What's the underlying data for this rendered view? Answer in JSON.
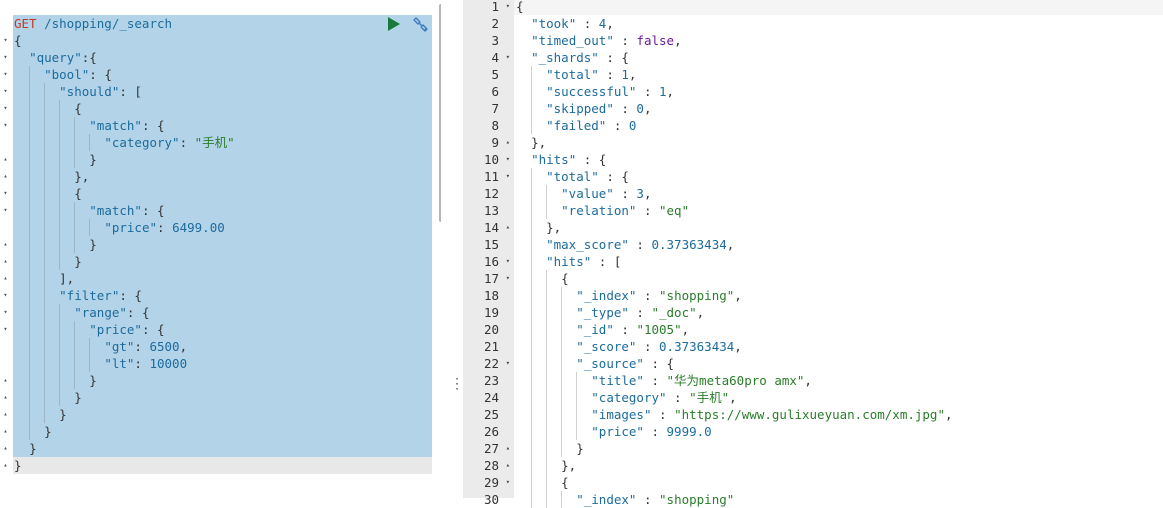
{
  "request": {
    "method": "GET",
    "path": " /shopping/_search",
    "run_icon": "play-icon",
    "settings_icon": "wrench-icon"
  },
  "request_lines": [
    {
      "i": 0,
      "parts": [
        {
          "t": "{",
          "c": "p"
        }
      ]
    },
    {
      "i": 1,
      "parts": [
        {
          "t": "\"query\"",
          "c": "k"
        },
        {
          "t": ":{",
          "c": "p"
        }
      ]
    },
    {
      "i": 2,
      "parts": [
        {
          "t": "\"bool\"",
          "c": "k"
        },
        {
          "t": ": {",
          "c": "p"
        }
      ]
    },
    {
      "i": 3,
      "parts": [
        {
          "t": "\"should\"",
          "c": "k"
        },
        {
          "t": ": [",
          "c": "p"
        }
      ]
    },
    {
      "i": 4,
      "parts": [
        {
          "t": "{",
          "c": "p"
        }
      ]
    },
    {
      "i": 5,
      "parts": [
        {
          "t": "\"match\"",
          "c": "k"
        },
        {
          "t": ": {",
          "c": "p"
        }
      ]
    },
    {
      "i": 6,
      "parts": [
        {
          "t": "\"category\"",
          "c": "k"
        },
        {
          "t": ": ",
          "c": "p"
        },
        {
          "t": "\"手机\"",
          "c": "z"
        }
      ]
    },
    {
      "i": 5,
      "parts": [
        {
          "t": "}",
          "c": "p"
        }
      ]
    },
    {
      "i": 4,
      "parts": [
        {
          "t": "},",
          "c": "p"
        }
      ]
    },
    {
      "i": 4,
      "parts": [
        {
          "t": "{",
          "c": "p"
        }
      ]
    },
    {
      "i": 5,
      "parts": [
        {
          "t": "\"match\"",
          "c": "k"
        },
        {
          "t": ": {",
          "c": "p"
        }
      ]
    },
    {
      "i": 6,
      "parts": [
        {
          "t": "\"price\"",
          "c": "k"
        },
        {
          "t": ": ",
          "c": "p"
        },
        {
          "t": "6499.00",
          "c": "n"
        }
      ]
    },
    {
      "i": 5,
      "parts": [
        {
          "t": "}",
          "c": "p"
        }
      ]
    },
    {
      "i": 4,
      "parts": [
        {
          "t": "}",
          "c": "p"
        }
      ]
    },
    {
      "i": 3,
      "parts": [
        {
          "t": "],",
          "c": "p"
        }
      ]
    },
    {
      "i": 3,
      "parts": [
        {
          "t": "\"filter\"",
          "c": "k"
        },
        {
          "t": ": {",
          "c": "p"
        }
      ]
    },
    {
      "i": 4,
      "parts": [
        {
          "t": "\"range\"",
          "c": "k"
        },
        {
          "t": ": {",
          "c": "p"
        }
      ]
    },
    {
      "i": 5,
      "parts": [
        {
          "t": "\"price\"",
          "c": "k"
        },
        {
          "t": ": {",
          "c": "p"
        }
      ]
    },
    {
      "i": 6,
      "parts": [
        {
          "t": "\"gt\"",
          "c": "k"
        },
        {
          "t": ": ",
          "c": "p"
        },
        {
          "t": "6500",
          "c": "n"
        },
        {
          "t": ",",
          "c": "p"
        }
      ]
    },
    {
      "i": 6,
      "parts": [
        {
          "t": "\"lt\"",
          "c": "k"
        },
        {
          "t": ": ",
          "c": "p"
        },
        {
          "t": "10000",
          "c": "n"
        }
      ]
    },
    {
      "i": 5,
      "parts": [
        {
          "t": "}",
          "c": "p"
        }
      ]
    },
    {
      "i": 4,
      "parts": [
        {
          "t": "}",
          "c": "p"
        }
      ]
    },
    {
      "i": 3,
      "parts": [
        {
          "t": "}",
          "c": "p"
        }
      ]
    },
    {
      "i": 2,
      "parts": [
        {
          "t": "}",
          "c": "p"
        }
      ]
    },
    {
      "i": 1,
      "parts": [
        {
          "t": "}",
          "c": "p"
        }
      ]
    },
    {
      "i": 0,
      "parts": [
        {
          "t": "}",
          "c": "p"
        }
      ]
    }
  ],
  "left_folds": [
    "▾",
    "▾",
    "▾",
    "▾",
    "▾",
    "▾",
    "",
    "▴",
    "▴",
    "▾",
    "▾",
    "",
    "▴",
    "▴",
    "▴",
    "▾",
    "▾",
    "▾",
    "",
    "",
    "▴",
    "▴",
    "▴",
    "▴",
    "▴",
    "▴"
  ],
  "response_lines": [
    {
      "n": "1",
      "a": "▾",
      "i": 0,
      "parts": [
        {
          "t": "{",
          "c": "p"
        }
      ]
    },
    {
      "n": "2",
      "a": "",
      "i": 1,
      "parts": [
        {
          "t": "\"took\"",
          "c": "k"
        },
        {
          "t": " : ",
          "c": "p"
        },
        {
          "t": "4",
          "c": "n"
        },
        {
          "t": ",",
          "c": "p"
        }
      ]
    },
    {
      "n": "3",
      "a": "",
      "i": 1,
      "parts": [
        {
          "t": "\"timed_out\"",
          "c": "k"
        },
        {
          "t": " : ",
          "c": "p"
        },
        {
          "t": "false",
          "c": "b"
        },
        {
          "t": ",",
          "c": "p"
        }
      ]
    },
    {
      "n": "4",
      "a": "▾",
      "i": 1,
      "parts": [
        {
          "t": "\"_shards\"",
          "c": "k"
        },
        {
          "t": " : {",
          "c": "p"
        }
      ]
    },
    {
      "n": "5",
      "a": "",
      "i": 2,
      "parts": [
        {
          "t": "\"total\"",
          "c": "k"
        },
        {
          "t": " : ",
          "c": "p"
        },
        {
          "t": "1",
          "c": "n"
        },
        {
          "t": ",",
          "c": "p"
        }
      ]
    },
    {
      "n": "6",
      "a": "",
      "i": 2,
      "parts": [
        {
          "t": "\"successful\"",
          "c": "k"
        },
        {
          "t": " : ",
          "c": "p"
        },
        {
          "t": "1",
          "c": "n"
        },
        {
          "t": ",",
          "c": "p"
        }
      ]
    },
    {
      "n": "7",
      "a": "",
      "i": 2,
      "parts": [
        {
          "t": "\"skipped\"",
          "c": "k"
        },
        {
          "t": " : ",
          "c": "p"
        },
        {
          "t": "0",
          "c": "n"
        },
        {
          "t": ",",
          "c": "p"
        }
      ]
    },
    {
      "n": "8",
      "a": "",
      "i": 2,
      "parts": [
        {
          "t": "\"failed\"",
          "c": "k"
        },
        {
          "t": " : ",
          "c": "p"
        },
        {
          "t": "0",
          "c": "n"
        }
      ]
    },
    {
      "n": "9",
      "a": "▴",
      "i": 1,
      "parts": [
        {
          "t": "},",
          "c": "p"
        }
      ]
    },
    {
      "n": "10",
      "a": "▾",
      "i": 1,
      "parts": [
        {
          "t": "\"hits\"",
          "c": "k"
        },
        {
          "t": " : {",
          "c": "p"
        }
      ]
    },
    {
      "n": "11",
      "a": "▾",
      "i": 2,
      "parts": [
        {
          "t": "\"total\"",
          "c": "k"
        },
        {
          "t": " : {",
          "c": "p"
        }
      ]
    },
    {
      "n": "12",
      "a": "",
      "i": 3,
      "parts": [
        {
          "t": "\"value\"",
          "c": "k"
        },
        {
          "t": " : ",
          "c": "p"
        },
        {
          "t": "3",
          "c": "n"
        },
        {
          "t": ",",
          "c": "p"
        }
      ]
    },
    {
      "n": "13",
      "a": "",
      "i": 3,
      "parts": [
        {
          "t": "\"relation\"",
          "c": "k"
        },
        {
          "t": " : ",
          "c": "p"
        },
        {
          "t": "\"eq\"",
          "c": "z"
        }
      ]
    },
    {
      "n": "14",
      "a": "▴",
      "i": 2,
      "parts": [
        {
          "t": "},",
          "c": "p"
        }
      ]
    },
    {
      "n": "15",
      "a": "",
      "i": 2,
      "parts": [
        {
          "t": "\"max_score\"",
          "c": "k"
        },
        {
          "t": " : ",
          "c": "p"
        },
        {
          "t": "0.37363434",
          "c": "n"
        },
        {
          "t": ",",
          "c": "p"
        }
      ]
    },
    {
      "n": "16",
      "a": "▾",
      "i": 2,
      "parts": [
        {
          "t": "\"hits\"",
          "c": "k"
        },
        {
          "t": " : [",
          "c": "p"
        }
      ]
    },
    {
      "n": "17",
      "a": "▾",
      "i": 3,
      "parts": [
        {
          "t": "{",
          "c": "p"
        }
      ]
    },
    {
      "n": "18",
      "a": "",
      "i": 4,
      "parts": [
        {
          "t": "\"_index\"",
          "c": "k"
        },
        {
          "t": " : ",
          "c": "p"
        },
        {
          "t": "\"shopping\"",
          "c": "z"
        },
        {
          "t": ",",
          "c": "p"
        }
      ]
    },
    {
      "n": "19",
      "a": "",
      "i": 4,
      "parts": [
        {
          "t": "\"_type\"",
          "c": "k"
        },
        {
          "t": " : ",
          "c": "p"
        },
        {
          "t": "\"_doc\"",
          "c": "z"
        },
        {
          "t": ",",
          "c": "p"
        }
      ]
    },
    {
      "n": "20",
      "a": "",
      "i": 4,
      "parts": [
        {
          "t": "\"_id\"",
          "c": "k"
        },
        {
          "t": " : ",
          "c": "p"
        },
        {
          "t": "\"1005\"",
          "c": "z"
        },
        {
          "t": ",",
          "c": "p"
        }
      ]
    },
    {
      "n": "21",
      "a": "",
      "i": 4,
      "parts": [
        {
          "t": "\"_score\"",
          "c": "k"
        },
        {
          "t": " : ",
          "c": "p"
        },
        {
          "t": "0.37363434",
          "c": "n"
        },
        {
          "t": ",",
          "c": "p"
        }
      ]
    },
    {
      "n": "22",
      "a": "▾",
      "i": 4,
      "parts": [
        {
          "t": "\"_source\"",
          "c": "k"
        },
        {
          "t": " : {",
          "c": "p"
        }
      ]
    },
    {
      "n": "23",
      "a": "",
      "i": 5,
      "parts": [
        {
          "t": "\"title\"",
          "c": "k"
        },
        {
          "t": " : ",
          "c": "p"
        },
        {
          "t": "\"华为meta60pro amx\"",
          "c": "z"
        },
        {
          "t": ",",
          "c": "p"
        }
      ]
    },
    {
      "n": "24",
      "a": "",
      "i": 5,
      "parts": [
        {
          "t": "\"category\"",
          "c": "k"
        },
        {
          "t": " : ",
          "c": "p"
        },
        {
          "t": "\"手机\"",
          "c": "z"
        },
        {
          "t": ",",
          "c": "p"
        }
      ]
    },
    {
      "n": "25",
      "a": "",
      "i": 5,
      "parts": [
        {
          "t": "\"images\"",
          "c": "k"
        },
        {
          "t": " : ",
          "c": "p"
        },
        {
          "t": "\"https://www.gulixueyuan.com/xm.jpg\"",
          "c": "z"
        },
        {
          "t": ",",
          "c": "p"
        }
      ]
    },
    {
      "n": "26",
      "a": "",
      "i": 5,
      "parts": [
        {
          "t": "\"price\"",
          "c": "k"
        },
        {
          "t": " : ",
          "c": "p"
        },
        {
          "t": "9999.0",
          "c": "n"
        }
      ]
    },
    {
      "n": "27",
      "a": "▴",
      "i": 4,
      "parts": [
        {
          "t": "}",
          "c": "p"
        }
      ]
    },
    {
      "n": "28",
      "a": "▴",
      "i": 3,
      "parts": [
        {
          "t": "},",
          "c": "p"
        }
      ]
    },
    {
      "n": "29",
      "a": "▾",
      "i": 3,
      "parts": [
        {
          "t": "{",
          "c": "p"
        }
      ]
    },
    {
      "n": "30",
      "a": "",
      "i": 4,
      "parts": [
        {
          "t": "\"_index\"",
          "c": "k"
        },
        {
          "t": " : ",
          "c": "p"
        },
        {
          "t": "\"shopping\"",
          "c": "z"
        }
      ]
    }
  ]
}
